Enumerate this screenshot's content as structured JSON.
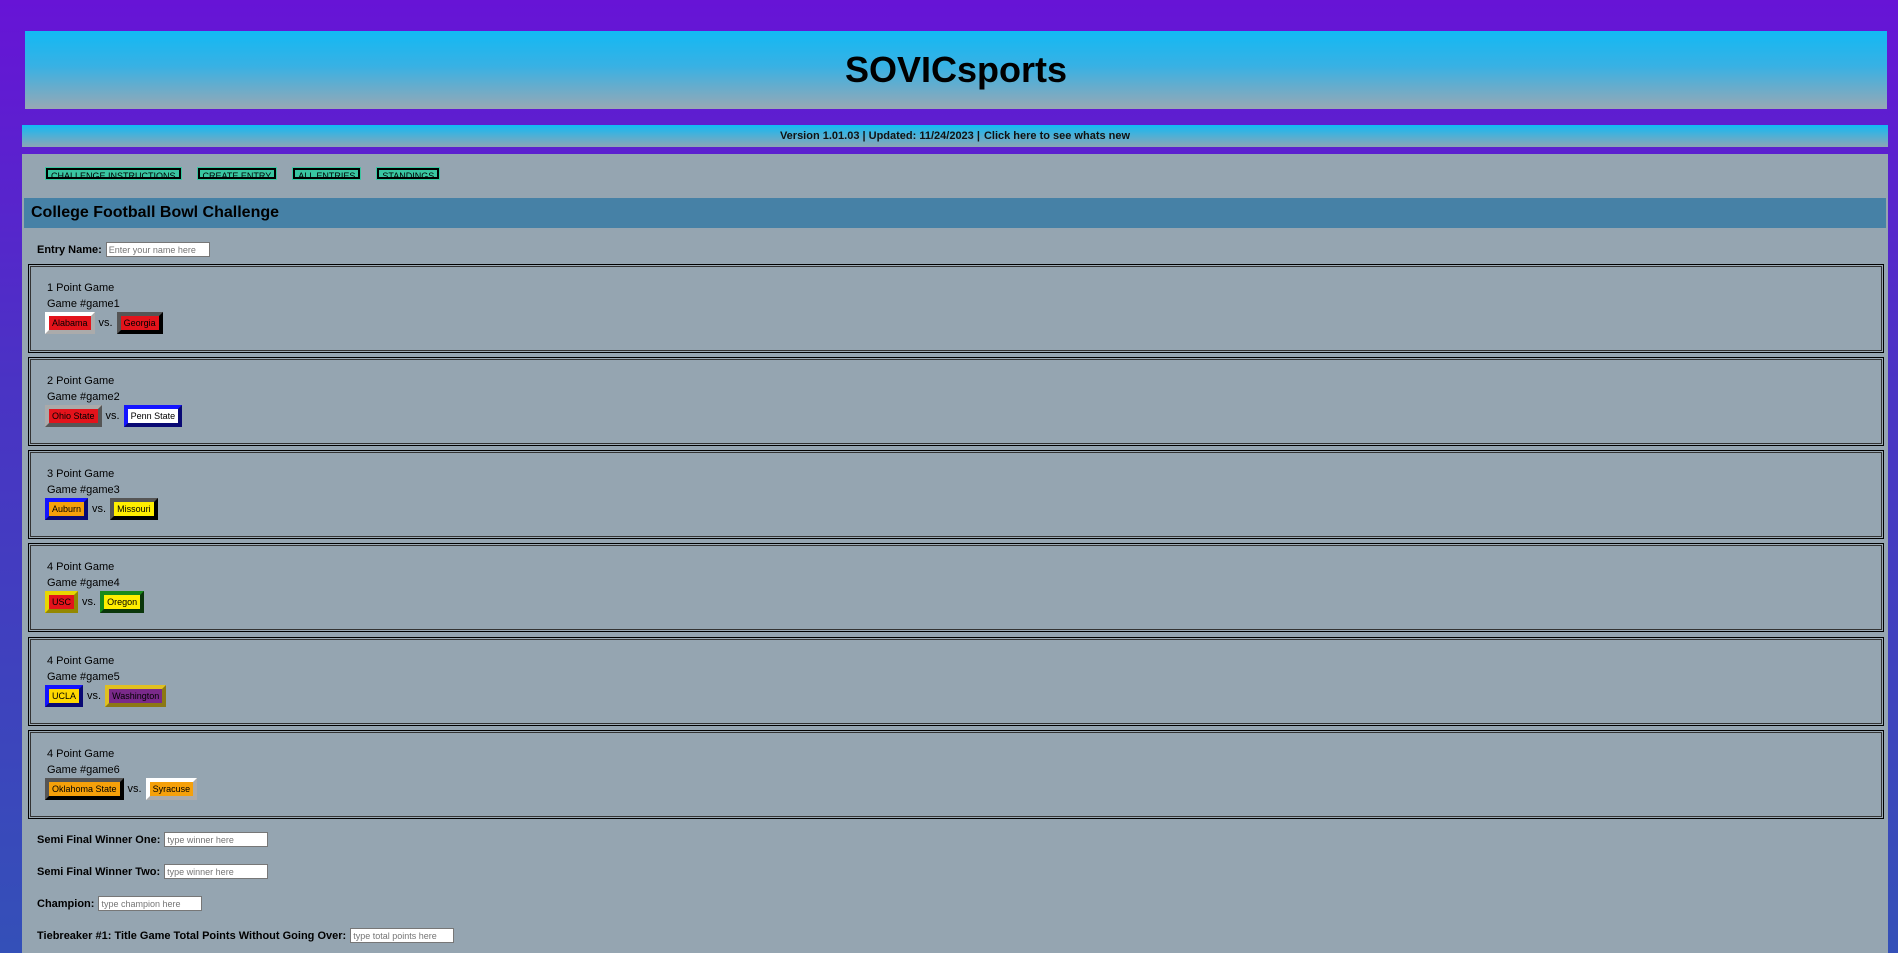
{
  "site_title": "SOVICsports",
  "version": {
    "text": "Version 1.01.03 | Updated: 11/24/2023 |",
    "link": "Click here to see whats new"
  },
  "nav": [
    "CHALLENGE INSTRUCTIONS",
    "CREATE ENTRY",
    "ALL ENTRIES",
    "STANDINGS"
  ],
  "page_title": "College Football Bowl Challenge",
  "entry": {
    "label": "Entry Name:",
    "placeholder": "Enter your name here"
  },
  "vs_label": "vs.",
  "games": [
    {
      "points": "1 Point Game",
      "game": "Game #game1",
      "team1": {
        "name": "Alabama",
        "bg": "#e3131b",
        "fg": "#000",
        "border": "#ffffff"
      },
      "team2": {
        "name": "Georgia",
        "bg": "#e3131b",
        "fg": "#000",
        "border": "#555555"
      }
    },
    {
      "points": "2 Point Game",
      "game": "Game #game2",
      "team1": {
        "name": "Ohio State",
        "bg": "#e3131b",
        "fg": "#000",
        "border": "#aaaaaa"
      },
      "team2": {
        "name": "Penn State",
        "bg": "#ffffff",
        "fg": "#000",
        "border": "#1010c8"
      }
    },
    {
      "points": "3 Point Game",
      "game": "Game #game3",
      "team1": {
        "name": "Auburn",
        "bg": "#f5a00a",
        "fg": "#000",
        "border": "#1010c8"
      },
      "team2": {
        "name": "Missouri",
        "bg": "#ffee00",
        "fg": "#000",
        "border": "#555555"
      }
    },
    {
      "points": "4 Point Game",
      "game": "Game #game4",
      "team1": {
        "name": "USC",
        "bg": "#e3131b",
        "fg": "#000",
        "border": "#e8d600"
      },
      "team2": {
        "name": "Oregon",
        "bg": "#ffee00",
        "fg": "#000",
        "border": "#1a8a1a"
      }
    },
    {
      "points": "4 Point Game",
      "game": "Game #game5",
      "team1": {
        "name": "UCLA",
        "bg": "#ffd700",
        "fg": "#000",
        "border": "#1010c8"
      },
      "team2": {
        "name": "Washington",
        "bg": "#7a2a8a",
        "fg": "#000",
        "border": "#e0c020"
      }
    },
    {
      "points": "4 Point Game",
      "game": "Game #game6",
      "team1": {
        "name": "Oklahoma State",
        "bg": "#f5a00a",
        "fg": "#000",
        "border": "#555555"
      },
      "team2": {
        "name": "Syracuse",
        "bg": "#f5a00a",
        "fg": "#000",
        "border": "#ffffff"
      }
    }
  ],
  "semi1": {
    "label": "Semi Final Winner One:",
    "placeholder": "type winner here"
  },
  "semi2": {
    "label": "Semi Final Winner Two:",
    "placeholder": "type winner here"
  },
  "champion": {
    "label": "Champion:",
    "placeholder": "type champion here"
  },
  "tiebreaker": {
    "label": "Tiebreaker #1: Title Game Total Points Without Going Over:",
    "placeholder": "type total points here"
  }
}
